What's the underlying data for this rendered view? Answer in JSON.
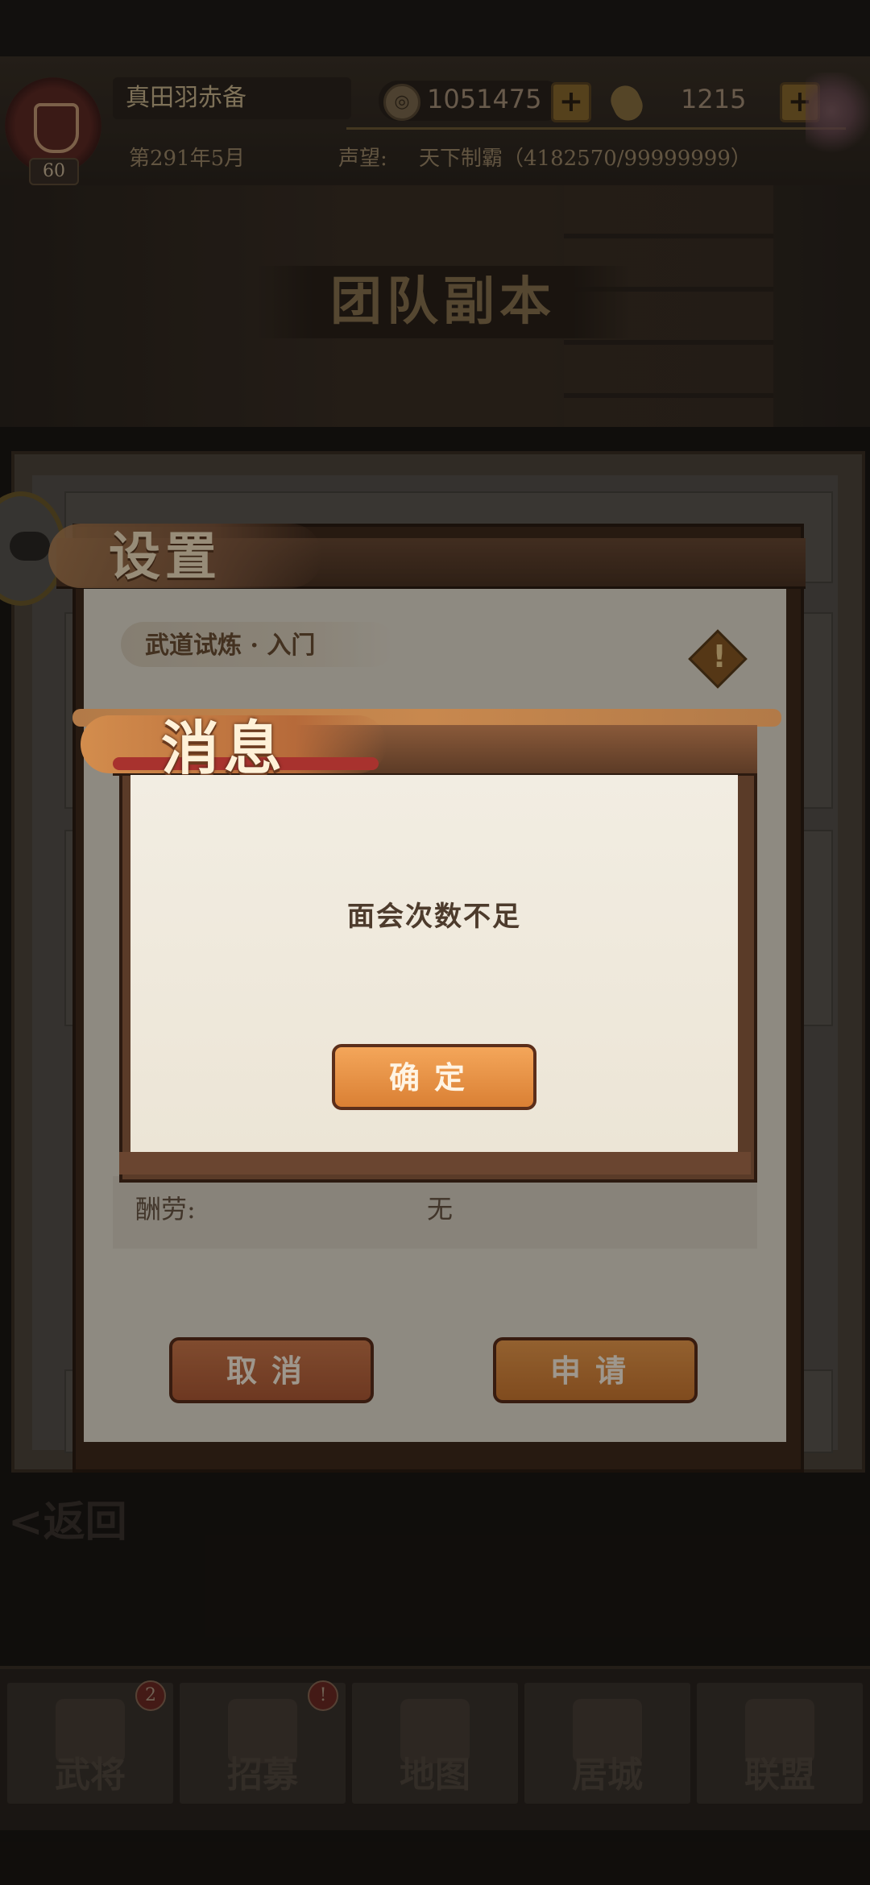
{
  "header": {
    "player_name": "真田羽赤备",
    "level": "60",
    "date": "第291年5月",
    "gold": "1051475",
    "koban": "1215",
    "prestige_label": "声望:",
    "prestige_value": "天下制霸（4182570/99999999）"
  },
  "banner": {
    "title": "团队副本"
  },
  "background": {
    "back_label": "<返回"
  },
  "nav": {
    "items": [
      {
        "label": "武将",
        "badge": "2"
      },
      {
        "label": "招募",
        "badge": "!"
      },
      {
        "label": "地图"
      },
      {
        "label": "居城"
      },
      {
        "label": "联盟"
      }
    ]
  },
  "settings_dialog": {
    "title": "设置",
    "level_tag": "武道试炼 · 入门",
    "warning_glyph": "!",
    "reward_label": "酬劳:",
    "reward_value": "无",
    "cancel_label": "取消",
    "apply_label": "申请"
  },
  "message_dialog": {
    "title": "消息",
    "text": "面会次数不足",
    "ok_label": "确定"
  },
  "colors": {
    "accent_orange": "#da8034",
    "dialog_paper": "#ece5d6",
    "frame_brown": "#5a3b28"
  }
}
